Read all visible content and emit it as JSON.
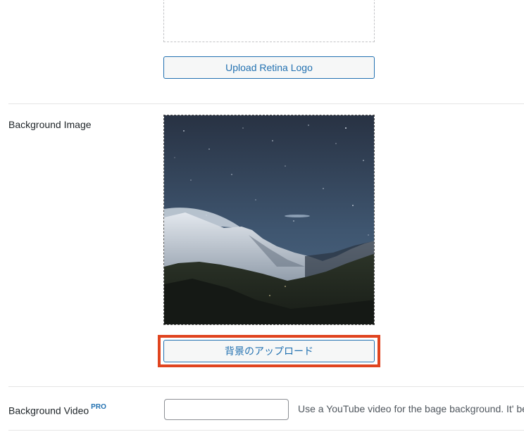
{
  "logo_section": {
    "upload_retina_label": "Upload Retina Logo"
  },
  "background_image": {
    "label": "Background Image",
    "upload_button_label": "背景のアップロード"
  },
  "background_video": {
    "label": "Background Video",
    "pro_badge": "PRO",
    "input_value": "",
    "help_text": "Use a YouTube video for the bage background. It' be"
  },
  "colors": {
    "button_accent": "#2271b1",
    "highlight": "#e0441f"
  }
}
